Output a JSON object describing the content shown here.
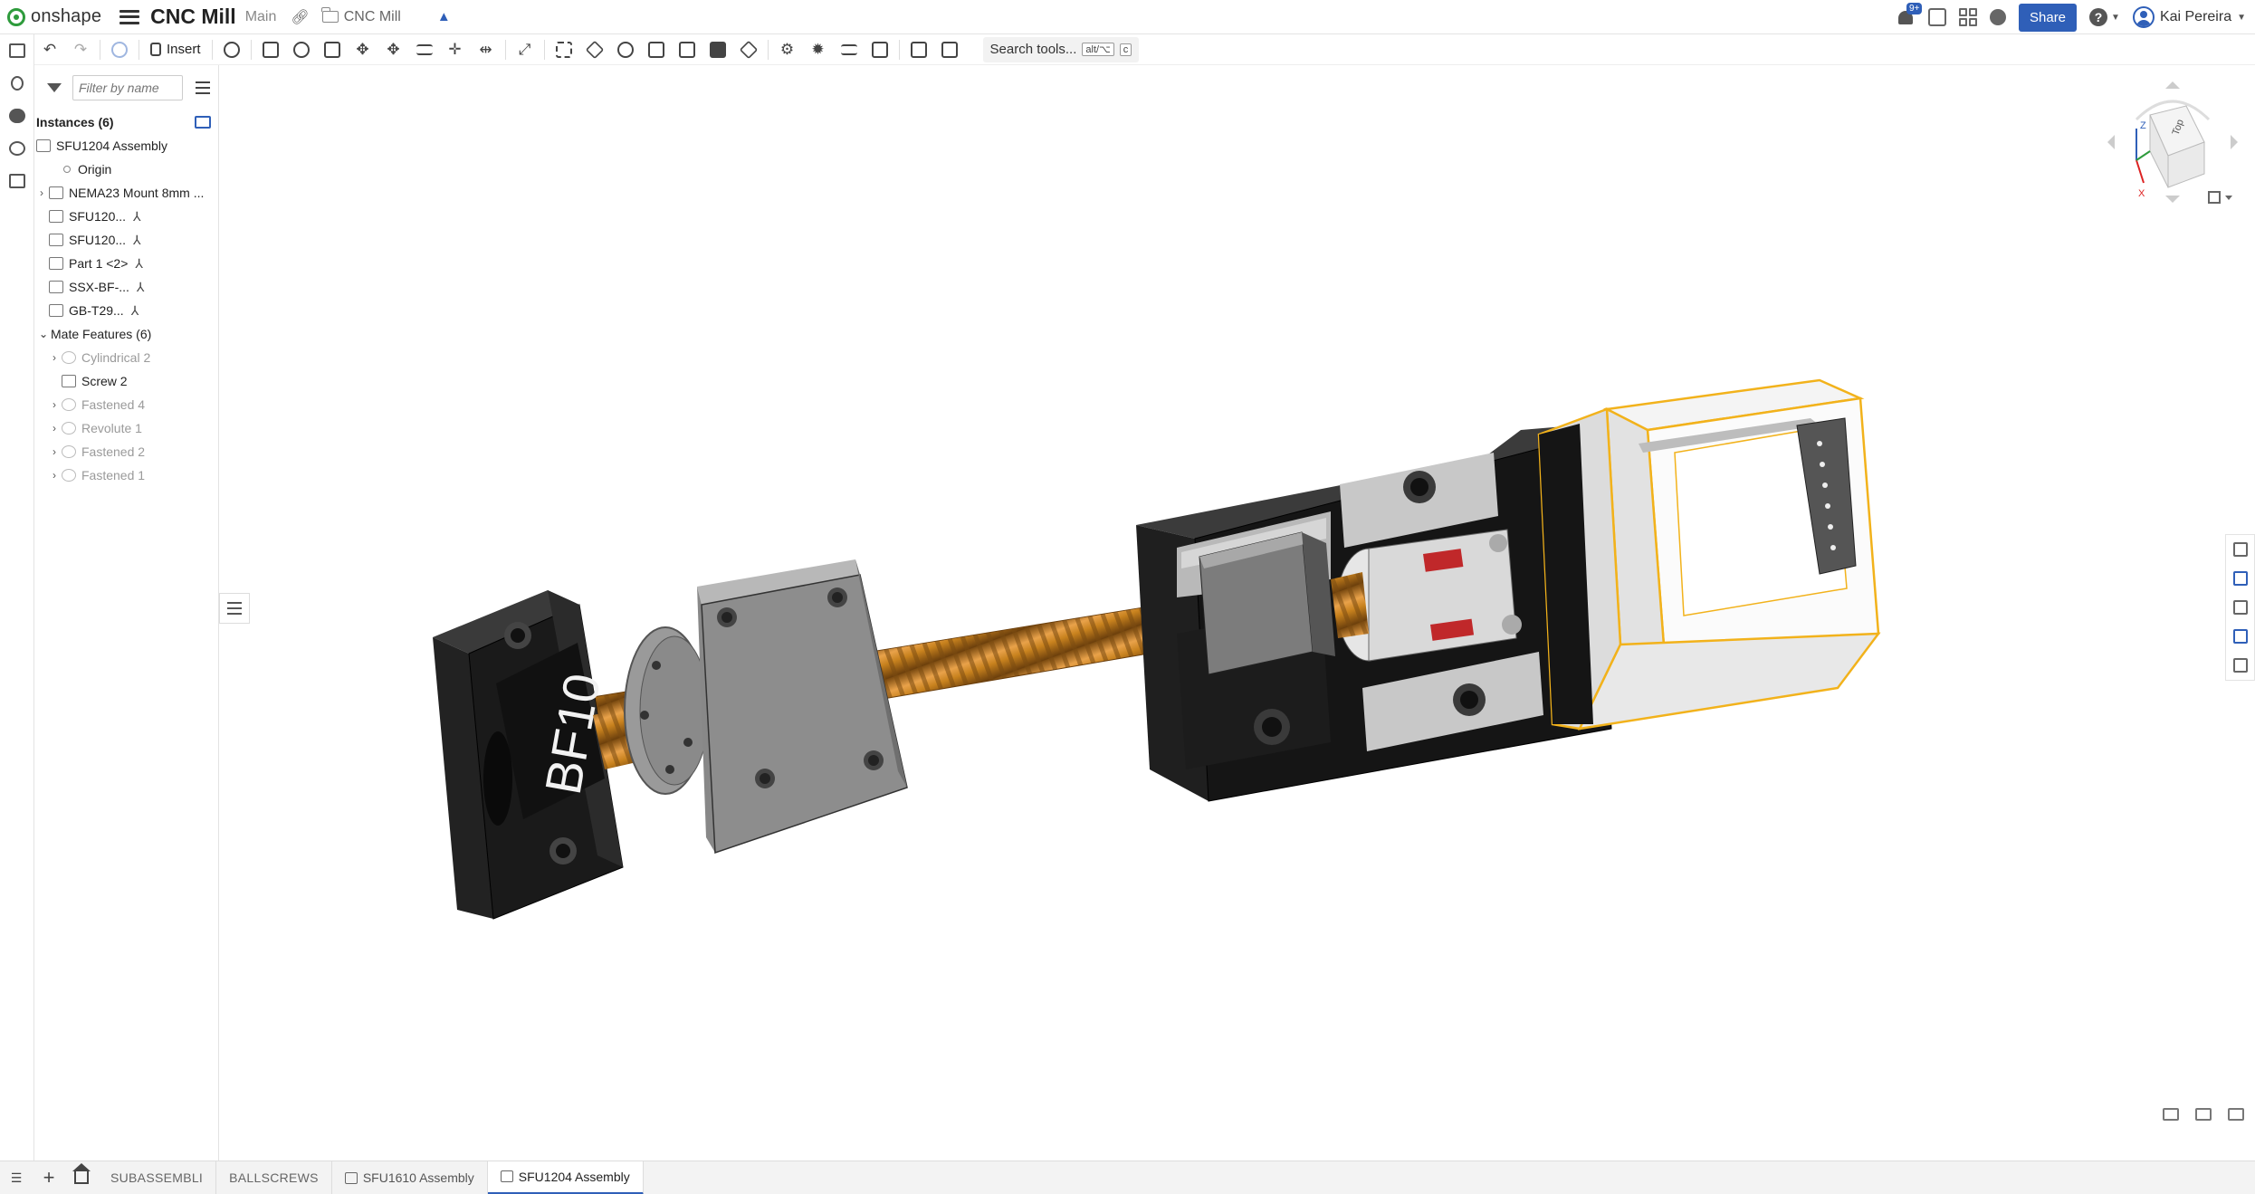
{
  "app": {
    "logo_text": "onshape",
    "document_title": "CNC Mill",
    "branch": "Main",
    "folder": "CNC Mill"
  },
  "topbar": {
    "notification_badge": "9+",
    "share_label": "Share",
    "help_label": "?",
    "user_name": "Kai Pereira"
  },
  "toolbar": {
    "insert_label": "Insert",
    "search_label": "Search tools...",
    "search_shortcut_1": "alt/⌥",
    "search_shortcut_2": "c"
  },
  "panel": {
    "filter_placeholder": "Filter by name",
    "instances_header": "Instances (6)",
    "instances": [
      {
        "label": "SFU1204 Assembly",
        "expandable": false
      },
      {
        "label": "Origin",
        "expandable": false
      },
      {
        "label": "NEMA23 Mount 8mm ...",
        "expandable": true
      },
      {
        "label": "SFU120...",
        "expandable": false
      },
      {
        "label": "SFU120...",
        "expandable": false
      },
      {
        "label": "Part 1 <2>",
        "expandable": false
      },
      {
        "label": "SSX-BF-...",
        "expandable": false
      },
      {
        "label": "GB-T29...",
        "expandable": false
      }
    ],
    "mates_header": "Mate Features (6)",
    "mates": [
      {
        "label": "Cylindrical 2",
        "dim": true
      },
      {
        "label": "Screw 2",
        "dim": false
      },
      {
        "label": "Fastened 4",
        "dim": true
      },
      {
        "label": "Revolute 1",
        "dim": true
      },
      {
        "label": "Fastened 2",
        "dim": true
      },
      {
        "label": "Fastened 1",
        "dim": true
      }
    ]
  },
  "viewport": {
    "part_engraving": "BF10",
    "viewcube_face": "Top",
    "axis_z": "Z",
    "axis_x": "X"
  },
  "tabs": {
    "folder_1": "SUBASSEMBLI",
    "folder_2": "BALLSCREWS",
    "tab_1": "SFU1610 Assembly",
    "tab_2": "SFU1204 Assembly"
  },
  "colors": {
    "accent": "#2f5fb8",
    "logo_green": "#2e9b3c",
    "screw_orange": "#c8821e",
    "selection_yellow": "#f2b21b",
    "coupler_red": "#c0282a"
  }
}
